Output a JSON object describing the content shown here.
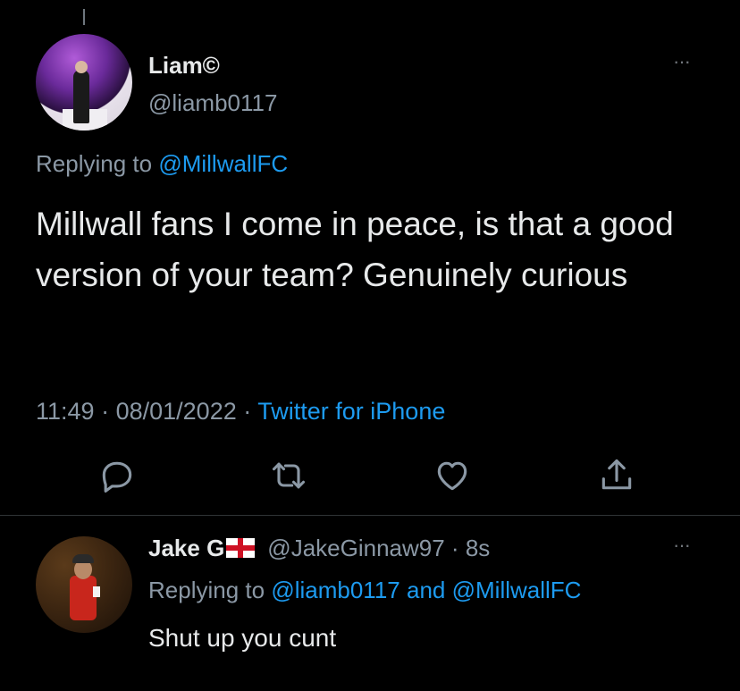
{
  "tweet": {
    "display_name": "Liam©",
    "handle": "@liamb0117",
    "replying_prefix": "Replying to",
    "replying_to": "@MillwallFC",
    "text": "Millwall fans I come in peace, is that a good version of your team? Genuinely curious",
    "time": "11:49",
    "date": "08/01/2022",
    "separator": "·",
    "source": "Twitter for iPhone",
    "actions": [
      "reply-icon",
      "retweet-icon",
      "like-icon",
      "share-icon"
    ]
  },
  "reply": {
    "display_name": "Jake G",
    "flag": "england-flag-icon",
    "handle": "@JakeGinnaw97",
    "separator": "·",
    "age": "8s",
    "replying_prefix": "Replying to",
    "replying_to_1": "@liamb0117",
    "and": "and",
    "replying_to_2": "@MillwallFC",
    "text": "Shut up you cunt"
  },
  "more_label": "···",
  "colors": {
    "background": "#000000",
    "text": "#e7e9ea",
    "secondary": "#8b98a5",
    "link": "#1d9bf0",
    "divider": "#2f3336"
  }
}
